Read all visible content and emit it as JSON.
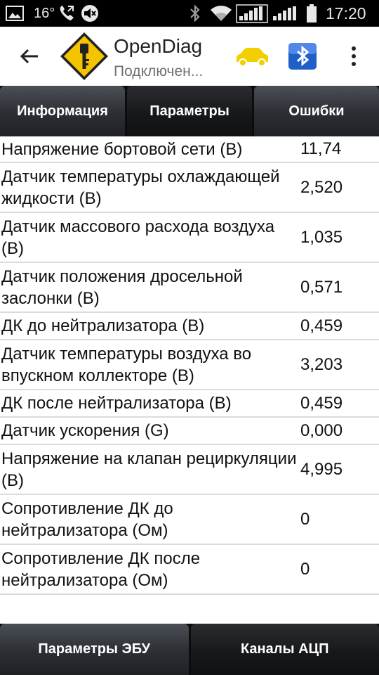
{
  "status_bar": {
    "temperature": "16°",
    "time": "17:20"
  },
  "app_bar": {
    "title": "OpenDiag",
    "subtitle": "Подключен..."
  },
  "tabs": [
    {
      "label": "Информация",
      "active": false
    },
    {
      "label": "Параметры",
      "active": true
    },
    {
      "label": "Ошибки",
      "active": false
    }
  ],
  "parameters": [
    {
      "name": "Напряжение бортовой сети (В)",
      "value": "11,74"
    },
    {
      "name": "Датчик температуры охлаждающей жидкости (В)",
      "value": "2,520"
    },
    {
      "name": "Датчик массового расхода воздуха (В)",
      "value": "1,035"
    },
    {
      "name": "Датчик положения дросельной заслонки (В)",
      "value": "0,571"
    },
    {
      "name": "ДК до нейтрализатора (В)",
      "value": "0,459"
    },
    {
      "name": "Датчик температуры воздуха во впускном коллекторе (В)",
      "value": "3,203"
    },
    {
      "name": "ДК после нейтрализатора (В)",
      "value": "0,459"
    },
    {
      "name": "Датчик ускорения (G)",
      "value": "0,000"
    },
    {
      "name": "Напряжение на клапан рециркуляции (В)",
      "value": "4,995"
    },
    {
      "name": "Сопротивление ДК до нейтрализатора (Ом)",
      "value": "0"
    },
    {
      "name": "Сопротивление ДК после нейтрализатора (Ом)",
      "value": "0"
    }
  ],
  "bottom_buttons": [
    {
      "label": "Параметры ЭБУ",
      "active": false
    },
    {
      "label": "Каналы АЦП",
      "active": true
    }
  ],
  "colors": {
    "logo_yellow": "#f5c400",
    "car_yellow": "#f2d000",
    "bluetooth_blue": "#1f5fc8"
  }
}
